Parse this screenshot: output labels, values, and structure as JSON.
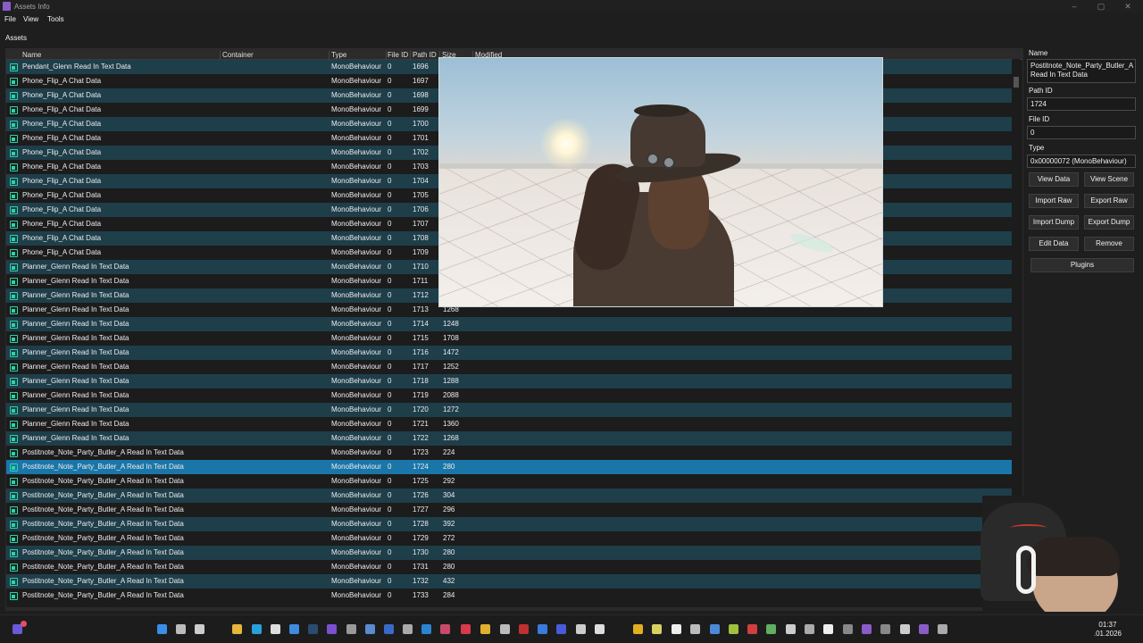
{
  "window": {
    "title": "Assets Info"
  },
  "menu": {
    "file": "File",
    "view": "View",
    "tools": "Tools"
  },
  "section": {
    "label": "Assets"
  },
  "columns": {
    "name": "Name",
    "container": "Container",
    "type": "Type",
    "file_id": "File ID",
    "path_id": "Path ID",
    "size": "Size",
    "modified": "Modified"
  },
  "rows": [
    {
      "name": "Pendant_Glenn Read In Text Data",
      "type": "MonoBehaviour",
      "file_id": "0",
      "path_id": "1696",
      "size": ""
    },
    {
      "name": "Phone_Flip_A Chat Data",
      "type": "MonoBehaviour",
      "file_id": "0",
      "path_id": "1697",
      "size": ""
    },
    {
      "name": "Phone_Flip_A Chat Data",
      "type": "MonoBehaviour",
      "file_id": "0",
      "path_id": "1698",
      "size": ""
    },
    {
      "name": "Phone_Flip_A Chat Data",
      "type": "MonoBehaviour",
      "file_id": "0",
      "path_id": "1699",
      "size": ""
    },
    {
      "name": "Phone_Flip_A Chat Data",
      "type": "MonoBehaviour",
      "file_id": "0",
      "path_id": "1700",
      "size": ""
    },
    {
      "name": "Phone_Flip_A Chat Data",
      "type": "MonoBehaviour",
      "file_id": "0",
      "path_id": "1701",
      "size": ""
    },
    {
      "name": "Phone_Flip_A Chat Data",
      "type": "MonoBehaviour",
      "file_id": "0",
      "path_id": "1702",
      "size": ""
    },
    {
      "name": "Phone_Flip_A Chat Data",
      "type": "MonoBehaviour",
      "file_id": "0",
      "path_id": "1703",
      "size": ""
    },
    {
      "name": "Phone_Flip_A Chat Data",
      "type": "MonoBehaviour",
      "file_id": "0",
      "path_id": "1704",
      "size": ""
    },
    {
      "name": "Phone_Flip_A Chat Data",
      "type": "MonoBehaviour",
      "file_id": "0",
      "path_id": "1705",
      "size": ""
    },
    {
      "name": "Phone_Flip_A Chat Data",
      "type": "MonoBehaviour",
      "file_id": "0",
      "path_id": "1706",
      "size": ""
    },
    {
      "name": "Phone_Flip_A Chat Data",
      "type": "MonoBehaviour",
      "file_id": "0",
      "path_id": "1707",
      "size": ""
    },
    {
      "name": "Phone_Flip_A Chat Data",
      "type": "MonoBehaviour",
      "file_id": "0",
      "path_id": "1708",
      "size": ""
    },
    {
      "name": "Phone_Flip_A Chat Data",
      "type": "MonoBehaviour",
      "file_id": "0",
      "path_id": "1709",
      "size": ""
    },
    {
      "name": "Planner_Glenn Read In Text Data",
      "type": "MonoBehaviour",
      "file_id": "0",
      "path_id": "1710",
      "size": ""
    },
    {
      "name": "Planner_Glenn Read In Text Data",
      "type": "MonoBehaviour",
      "file_id": "0",
      "path_id": "1711",
      "size": ""
    },
    {
      "name": "Planner_Glenn Read In Text Data",
      "type": "MonoBehaviour",
      "file_id": "0",
      "path_id": "1712",
      "size": ""
    },
    {
      "name": "Planner_Glenn Read In Text Data",
      "type": "MonoBehaviour",
      "file_id": "0",
      "path_id": "1713",
      "size": "1268"
    },
    {
      "name": "Planner_Glenn Read In Text Data",
      "type": "MonoBehaviour",
      "file_id": "0",
      "path_id": "1714",
      "size": "1248"
    },
    {
      "name": "Planner_Glenn Read In Text Data",
      "type": "MonoBehaviour",
      "file_id": "0",
      "path_id": "1715",
      "size": "1708"
    },
    {
      "name": "Planner_Glenn Read In Text Data",
      "type": "MonoBehaviour",
      "file_id": "0",
      "path_id": "1716",
      "size": "1472"
    },
    {
      "name": "Planner_Glenn Read In Text Data",
      "type": "MonoBehaviour",
      "file_id": "0",
      "path_id": "1717",
      "size": "1252"
    },
    {
      "name": "Planner_Glenn Read In Text Data",
      "type": "MonoBehaviour",
      "file_id": "0",
      "path_id": "1718",
      "size": "1288"
    },
    {
      "name": "Planner_Glenn Read In Text Data",
      "type": "MonoBehaviour",
      "file_id": "0",
      "path_id": "1719",
      "size": "2088"
    },
    {
      "name": "Planner_Glenn Read In Text Data",
      "type": "MonoBehaviour",
      "file_id": "0",
      "path_id": "1720",
      "size": "1272"
    },
    {
      "name": "Planner_Glenn Read In Text Data",
      "type": "MonoBehaviour",
      "file_id": "0",
      "path_id": "1721",
      "size": "1360"
    },
    {
      "name": "Planner_Glenn Read In Text Data",
      "type": "MonoBehaviour",
      "file_id": "0",
      "path_id": "1722",
      "size": "1268"
    },
    {
      "name": "Postitnote_Note_Party_Butler_A Read In Text Data",
      "type": "MonoBehaviour",
      "file_id": "0",
      "path_id": "1723",
      "size": "224"
    },
    {
      "name": "Postitnote_Note_Party_Butler_A Read In Text Data",
      "type": "MonoBehaviour",
      "file_id": "0",
      "path_id": "1724",
      "size": "280",
      "selected": true
    },
    {
      "name": "Postitnote_Note_Party_Butler_A Read In Text Data",
      "type": "MonoBehaviour",
      "file_id": "0",
      "path_id": "1725",
      "size": "292"
    },
    {
      "name": "Postitnote_Note_Party_Butler_A Read In Text Data",
      "type": "MonoBehaviour",
      "file_id": "0",
      "path_id": "1726",
      "size": "304"
    },
    {
      "name": "Postitnote_Note_Party_Butler_A Read In Text Data",
      "type": "MonoBehaviour",
      "file_id": "0",
      "path_id": "1727",
      "size": "296"
    },
    {
      "name": "Postitnote_Note_Party_Butler_A Read In Text Data",
      "type": "MonoBehaviour",
      "file_id": "0",
      "path_id": "1728",
      "size": "392"
    },
    {
      "name": "Postitnote_Note_Party_Butler_A Read In Text Data",
      "type": "MonoBehaviour",
      "file_id": "0",
      "path_id": "1729",
      "size": "272"
    },
    {
      "name": "Postitnote_Note_Party_Butler_A Read In Text Data",
      "type": "MonoBehaviour",
      "file_id": "0",
      "path_id": "1730",
      "size": "280"
    },
    {
      "name": "Postitnote_Note_Party_Butler_A Read In Text Data",
      "type": "MonoBehaviour",
      "file_id": "0",
      "path_id": "1731",
      "size": "280"
    },
    {
      "name": "Postitnote_Note_Party_Butler_A Read In Text Data",
      "type": "MonoBehaviour",
      "file_id": "0",
      "path_id": "1732",
      "size": "432"
    },
    {
      "name": "Postitnote_Note_Party_Butler_A Read In Text Data",
      "type": "MonoBehaviour",
      "file_id": "0",
      "path_id": "1733",
      "size": "284"
    }
  ],
  "details": {
    "name_label": "Name",
    "name_value": "Postitnote_Note_Party_Butler_A Read In Text Data",
    "path_id_label": "Path ID",
    "path_id_value": "1724",
    "file_id_label": "File ID",
    "file_id_value": "0",
    "type_label": "Type",
    "type_value": "0x00000072 (MonoBehaviour)"
  },
  "buttons": {
    "view_data": "View Data",
    "view_scene": "View Scene",
    "import_raw": "Import Raw",
    "export_raw": "Export Raw",
    "import_dump": "Import Dump",
    "export_dump": "Export Dump",
    "edit_data": "Edit Data",
    "remove": "Remove",
    "plugins": "Plugins"
  },
  "clock": {
    "time": "01:37",
    "date": ".01.2026"
  },
  "colors": {
    "row_alt": "#1e3e4a",
    "row_selected": "#1a76a8",
    "icon_teal": "#2bd4a8"
  },
  "icons": [
    "app-icon",
    "script-asset-icon",
    "notification-icon",
    "windows-start-icon",
    "search-icon"
  ]
}
